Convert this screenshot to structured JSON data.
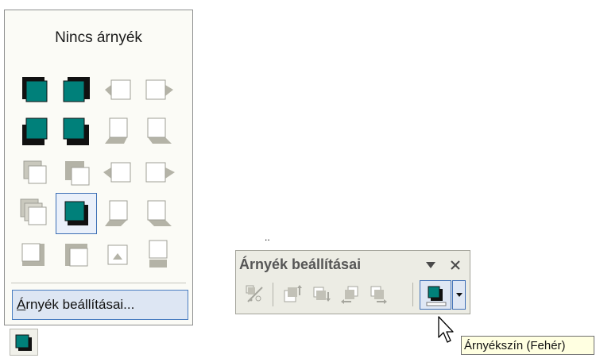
{
  "shadow_menu": {
    "no_shadow_label": "Nincs árnyék",
    "settings_button_accel": "Á",
    "settings_button_rest": "rnyék beállításai...",
    "styles": [
      "shadow-style-1-icon",
      "shadow-style-2-icon",
      "shadow-style-3-icon",
      "shadow-style-4-icon",
      "shadow-style-5-icon",
      "shadow-style-6-icon",
      "shadow-style-7-icon",
      "shadow-style-8-icon",
      "shadow-style-9-icon",
      "shadow-style-10-icon",
      "shadow-style-11-icon",
      "shadow-style-12-icon",
      "shadow-style-13-icon",
      "shadow-style-14-icon",
      "shadow-style-15-icon",
      "shadow-style-16-icon",
      "shadow-style-17-icon",
      "shadow-style-18-icon",
      "shadow-style-19-icon",
      "shadow-style-20-icon"
    ],
    "selected_style": 14
  },
  "floating_toolbar": {
    "title": "Árnyék beállításai",
    "buttons": [
      "shadow-on-off-icon",
      "nudge-shadow-up-icon",
      "nudge-shadow-down-icon",
      "nudge-shadow-left-icon",
      "nudge-shadow-right-icon",
      "shadow-color-icon",
      "dropdown-arrow-icon"
    ]
  },
  "stray_mark": "..",
  "tooltip": {
    "text": "Árnyékszín (Fehér)"
  },
  "colors": {
    "shadow_fill": "#00807a",
    "shadow_dark": "#111111",
    "shadow_gray": "#b4b3a7",
    "selection_border": "#3c6fb4",
    "tooltip_bg": "#ffffe1"
  }
}
